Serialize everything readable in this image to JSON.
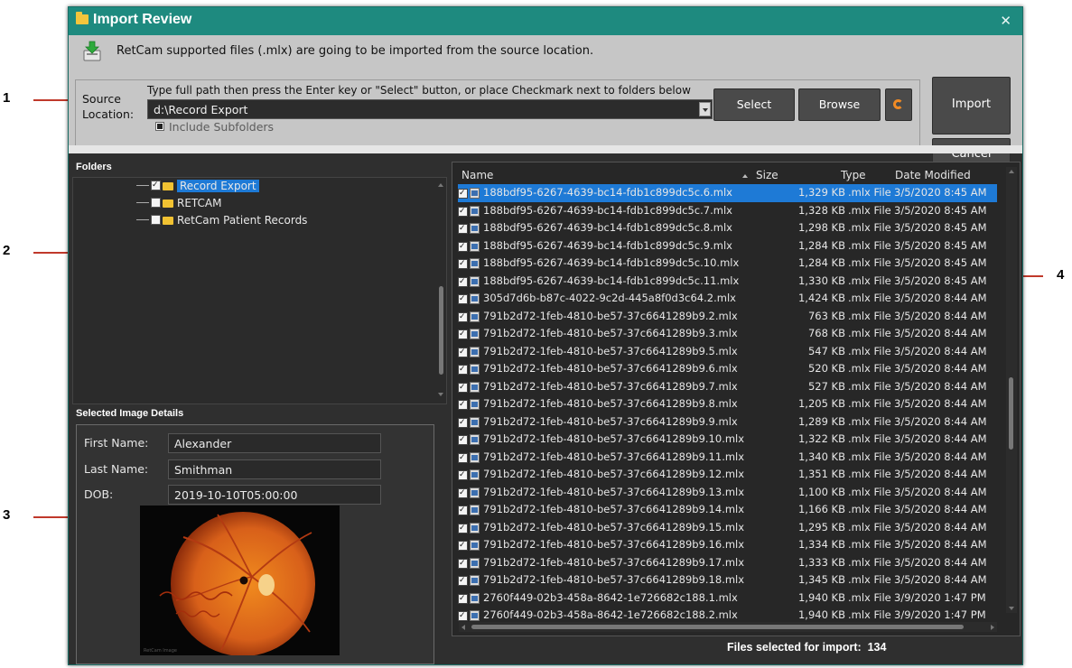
{
  "callouts": [
    "1",
    "2",
    "3",
    "4"
  ],
  "window": {
    "title": "Import Review",
    "close_glyph": "✕"
  },
  "info": {
    "icon": "download-icon",
    "text": "RetCam supported files (.mlx) are going to be imported from the source location."
  },
  "source": {
    "label": "Source Location:",
    "hint": "Type full path then press the Enter key or \"Select\" button, or place Checkmark next to folders below",
    "path_value": "d:\\Record Export",
    "include_subfolders_label": "Include Subfolders",
    "include_subfolders_checked": true
  },
  "buttons": {
    "select": "Select",
    "browse": "Browse",
    "refresh_icon": "refresh-icon",
    "import": "Import",
    "cancel": "Cancel"
  },
  "folders": {
    "title": "Folders",
    "items": [
      {
        "label": "Record Export",
        "checked": true,
        "selected": true
      },
      {
        "label": "RETCAM",
        "checked": false,
        "selected": false
      },
      {
        "label": "RetCam Patient Records",
        "checked": false,
        "selected": false
      }
    ]
  },
  "details": {
    "title": "Selected Image Details",
    "first_name_label": "First Name:",
    "first_name": "Alexander",
    "last_name_label": "Last Name:",
    "last_name": "Smithman",
    "dob_label": "DOB:",
    "dob": "2019-10-10T05:00:00",
    "image_caption": "RetCam Image"
  },
  "files": {
    "columns": [
      "Name",
      "Size",
      "Type",
      "Date Modified"
    ],
    "sort_column": "Size",
    "rows": [
      {
        "name": "188bdf95-6267-4639-bc14-fdb1c899dc5c.6.mlx",
        "size": "1,329 KB",
        "type": ".mlx File",
        "date": "3/5/2020 8:45 AM",
        "selected": true
      },
      {
        "name": "188bdf95-6267-4639-bc14-fdb1c899dc5c.7.mlx",
        "size": "1,328 KB",
        "type": ".mlx File",
        "date": "3/5/2020 8:45 AM"
      },
      {
        "name": "188bdf95-6267-4639-bc14-fdb1c899dc5c.8.mlx",
        "size": "1,298 KB",
        "type": ".mlx File",
        "date": "3/5/2020 8:45 AM"
      },
      {
        "name": "188bdf95-6267-4639-bc14-fdb1c899dc5c.9.mlx",
        "size": "1,284 KB",
        "type": ".mlx File",
        "date": "3/5/2020 8:45 AM"
      },
      {
        "name": "188bdf95-6267-4639-bc14-fdb1c899dc5c.10.mlx",
        "size": "1,284 KB",
        "type": ".mlx File",
        "date": "3/5/2020 8:45 AM"
      },
      {
        "name": "188bdf95-6267-4639-bc14-fdb1c899dc5c.11.mlx",
        "size": "1,330 KB",
        "type": ".mlx File",
        "date": "3/5/2020 8:45 AM"
      },
      {
        "name": "305d7d6b-b87c-4022-9c2d-445a8f0d3c64.2.mlx",
        "size": "1,424 KB",
        "type": ".mlx File",
        "date": "3/5/2020 8:44 AM"
      },
      {
        "name": "791b2d72-1feb-4810-be57-37c6641289b9.2.mlx",
        "size": "763 KB",
        "type": ".mlx File",
        "date": "3/5/2020 8:44 AM"
      },
      {
        "name": "791b2d72-1feb-4810-be57-37c6641289b9.3.mlx",
        "size": "768 KB",
        "type": ".mlx File",
        "date": "3/5/2020 8:44 AM"
      },
      {
        "name": "791b2d72-1feb-4810-be57-37c6641289b9.5.mlx",
        "size": "547 KB",
        "type": ".mlx File",
        "date": "3/5/2020 8:44 AM"
      },
      {
        "name": "791b2d72-1feb-4810-be57-37c6641289b9.6.mlx",
        "size": "520 KB",
        "type": ".mlx File",
        "date": "3/5/2020 8:44 AM"
      },
      {
        "name": "791b2d72-1feb-4810-be57-37c6641289b9.7.mlx",
        "size": "527 KB",
        "type": ".mlx File",
        "date": "3/5/2020 8:44 AM"
      },
      {
        "name": "791b2d72-1feb-4810-be57-37c6641289b9.8.mlx",
        "size": "1,205 KB",
        "type": ".mlx File",
        "date": "3/5/2020 8:44 AM"
      },
      {
        "name": "791b2d72-1feb-4810-be57-37c6641289b9.9.mlx",
        "size": "1,289 KB",
        "type": ".mlx File",
        "date": "3/5/2020 8:44 AM"
      },
      {
        "name": "791b2d72-1feb-4810-be57-37c6641289b9.10.mlx",
        "size": "1,322 KB",
        "type": ".mlx File",
        "date": "3/5/2020 8:44 AM"
      },
      {
        "name": "791b2d72-1feb-4810-be57-37c6641289b9.11.mlx",
        "size": "1,340 KB",
        "type": ".mlx File",
        "date": "3/5/2020 8:44 AM"
      },
      {
        "name": "791b2d72-1feb-4810-be57-37c6641289b9.12.mlx",
        "size": "1,351 KB",
        "type": ".mlx File",
        "date": "3/5/2020 8:44 AM"
      },
      {
        "name": "791b2d72-1feb-4810-be57-37c6641289b9.13.mlx",
        "size": "1,100 KB",
        "type": ".mlx File",
        "date": "3/5/2020 8:44 AM"
      },
      {
        "name": "791b2d72-1feb-4810-be57-37c6641289b9.14.mlx",
        "size": "1,166 KB",
        "type": ".mlx File",
        "date": "3/5/2020 8:44 AM"
      },
      {
        "name": "791b2d72-1feb-4810-be57-37c6641289b9.15.mlx",
        "size": "1,295 KB",
        "type": ".mlx File",
        "date": "3/5/2020 8:44 AM"
      },
      {
        "name": "791b2d72-1feb-4810-be57-37c6641289b9.16.mlx",
        "size": "1,334 KB",
        "type": ".mlx File",
        "date": "3/5/2020 8:44 AM"
      },
      {
        "name": "791b2d72-1feb-4810-be57-37c6641289b9.17.mlx",
        "size": "1,333 KB",
        "type": ".mlx File",
        "date": "3/5/2020 8:44 AM"
      },
      {
        "name": "791b2d72-1feb-4810-be57-37c6641289b9.18.mlx",
        "size": "1,345 KB",
        "type": ".mlx File",
        "date": "3/5/2020 8:44 AM"
      },
      {
        "name": "2760f449-02b3-458a-8642-1e726682c188.1.mlx",
        "size": "1,940 KB",
        "type": ".mlx File",
        "date": "3/9/2020 1:47 PM"
      },
      {
        "name": "2760f449-02b3-458a-8642-1e726682c188.2.mlx",
        "size": "1,940 KB",
        "type": ".mlx File",
        "date": "3/9/2020 1:47 PM"
      }
    ]
  },
  "status": {
    "label": "Files selected for import:",
    "count": "134"
  },
  "colors": {
    "title_bar": "#1e8a7f",
    "selection": "#1e7ad6",
    "callout_line": "#c0392b"
  }
}
